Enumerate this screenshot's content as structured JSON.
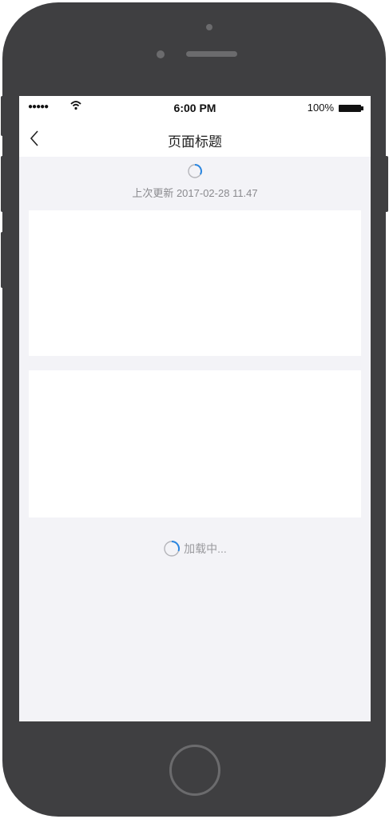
{
  "status_bar": {
    "signal": "●●●●●",
    "time": "6:00 PM",
    "battery": "100%"
  },
  "nav": {
    "back_icon": "chevron-left-icon",
    "title": "页面标题"
  },
  "pull_refresh": {
    "icon": "spinner-icon",
    "text": "上次更新 2017-02-28 11.47"
  },
  "load_more": {
    "icon": "spinner-icon",
    "text": "加载中..."
  },
  "colors": {
    "device_body": "#3f3f41",
    "screen_background": "#f3f3f7",
    "spinner_accent": "#2a86e0",
    "spinner_track": "#b5b5ba"
  }
}
